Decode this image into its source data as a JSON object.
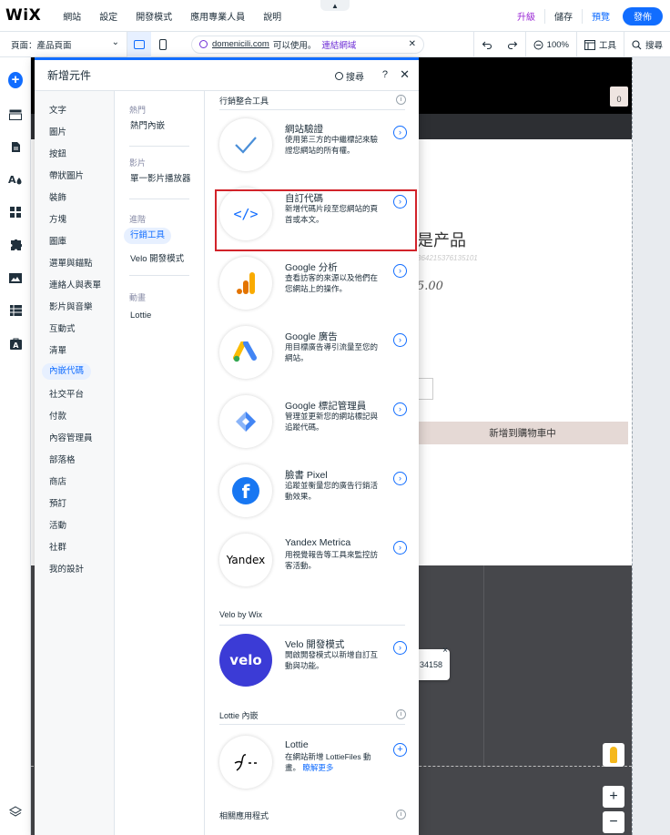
{
  "app": {
    "logo": "WiX",
    "menu": [
      "網站",
      "設定",
      "開發模式",
      "應用專業人員",
      "說明"
    ],
    "upgrade": "升級",
    "save": "儲存",
    "preview": "預覽",
    "publish": "發佈",
    "collapse_glyph": "▲"
  },
  "toolbar": {
    "page_label": "頁面：產品頁面",
    "domain": "domenicili.com",
    "available": "可以使用。",
    "connect": "連結網域",
    "zoom": "100%",
    "tools": "工具",
    "search": "搜尋",
    "close_glyph": "✕"
  },
  "panel": {
    "title": "新增元件",
    "search": "搜尋",
    "help": "?",
    "close": "✕",
    "categories": [
      "文字",
      "圖片",
      "按鈕",
      "帶狀圖片",
      "裝飾",
      "方塊",
      "圖庫",
      "選單與錨點",
      "連絡人與表單",
      "影片與音樂",
      "互動式",
      "清單",
      "內嵌代碼",
      "社交平台",
      "付款",
      "內容管理員",
      "部落格",
      "商店",
      "預訂",
      "活動",
      "社群",
      "我的設計"
    ],
    "active_category": "內嵌代碼",
    "subs": {
      "h_popular": "熱門",
      "popular": "熱門內嵌",
      "h_video": "影片",
      "video": "單一影片播放器",
      "h_advanced": "進階",
      "marketing": "行銷工具",
      "velo": "Velo 開發模式",
      "h_animation": "動畫",
      "lottie": "Lottie"
    },
    "sections": {
      "marketing_h": "行銷整合工具",
      "velo_h": "Velo by Wix",
      "lottie_h": "Lottie 內嵌",
      "related_h": "相關應用程式"
    },
    "cards": [
      {
        "title": "網站驗證",
        "desc": "使用第三方的中繼標記來驗證您網站的所有權。"
      },
      {
        "title": "自訂代碼",
        "desc": "新增代碼片段至您網站的頁首或本文。"
      },
      {
        "title": "Google 分析",
        "desc": "查看訪客的來源以及他們在您網站上的操作。"
      },
      {
        "title": "Google 廣告",
        "desc": "用目標廣告導引流量至您的網站。"
      },
      {
        "title": "Google 標記管理員",
        "desc": "管理並更新您的網站標記與追蹤代碼。"
      },
      {
        "title": "臉書 Pixel",
        "desc": "追蹤並衡量您的廣告行銷活動效果。"
      },
      {
        "title": "Yandex Metrica",
        "desc": "用視覺報告等工具來監控訪客活動。"
      },
      {
        "title": "Velo 開發模式",
        "desc": "開啟開發模式以新增自訂互動與功能。"
      },
      {
        "title": "Lottie",
        "desc": "在網站新增 LottieFiles 動畫。",
        "more": "瞭解更多"
      }
    ],
    "icon_labels": {
      "custom_code": "</>",
      "yandex": "Yandex",
      "velo": "velo",
      "facebook": "f"
    }
  },
  "site": {
    "product_title": "是产品",
    "sku": "364215376135101",
    "price": "5.00",
    "add_to_cart": "新增到購物車中",
    "tooltip": "34158",
    "bag_count": "0"
  },
  "colors": {
    "accent": "#116dff",
    "upgrade": "#9a27d5",
    "highlight": "#d2232a"
  }
}
